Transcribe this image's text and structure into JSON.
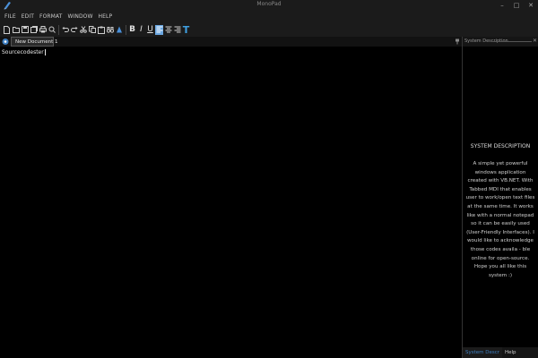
{
  "window": {
    "title": "MonoPad",
    "controls": {
      "minimize": "–",
      "maximize": "□",
      "close": "✕"
    }
  },
  "menu": [
    "FILE",
    "EDIT",
    "FORMAT",
    "WINDOW",
    "HELP"
  ],
  "toolbar": {
    "bold": "B",
    "italic": "I",
    "underline": "U",
    "font_color": "T"
  },
  "document_tab": {
    "label": "New Document 1"
  },
  "editor": {
    "content": "Sourcecodester"
  },
  "side_panel": {
    "title": "System Description",
    "heading": "SYSTEM DESCRIPTION",
    "description": "A simple yet powerful windows application created with VB.NET. With Tabbed MDI that enables user to work/open text files at the same time. It works like with a normal notepad so it can be easily used (User-Friendly Interfaces). I would like to acknowledge those codes availa - ble online for open-source. Hope you all like this system :)",
    "tabs": [
      "System Description",
      "Help"
    ]
  },
  "colors": {
    "accent": "#3f7fc0",
    "background": "#000000",
    "chrome": "#1b1b1b"
  }
}
